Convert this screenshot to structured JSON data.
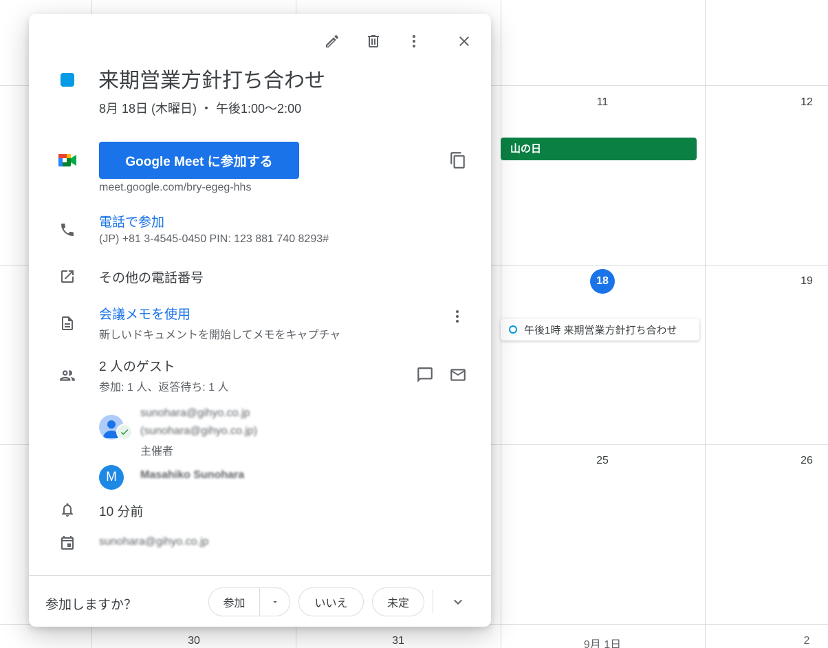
{
  "calendar": {
    "days": [
      "11",
      "12",
      "18",
      "19",
      "25",
      "26",
      "30",
      "31",
      "9月 1日",
      "2"
    ],
    "holiday": "山の日",
    "event_chip": "午後1時 来期営業方針打ち合わせ",
    "colors": {
      "today": "#1a73e8",
      "holiday": "#0b8043",
      "event": "#039be5"
    }
  },
  "popup": {
    "toolbar": {
      "edit": "pencil-icon",
      "delete": "trash-icon",
      "more": "more-vert-icon",
      "close": "close-icon"
    },
    "title": "来期営業方針打ち合わせ",
    "datetime": "8月 18日 (木曜日) ・ 午後1:00～2:00",
    "meet": {
      "button": "Google Meet に参加する",
      "url": "meet.google.com/bry-egeg-hhs"
    },
    "phone": {
      "link": "電話で参加",
      "detail": "(JP) +81 3-4545-0450 PIN: 123 881 740 8293#"
    },
    "more_numbers": "その他の電話番号",
    "notes": {
      "link": "会議メモを使用",
      "detail": "新しいドキュメントを開始してメモをキャプチャ"
    },
    "guests": {
      "heading": "2 人のゲスト",
      "summary": "参加: 1 人、返答待ち: 1 人",
      "list": [
        {
          "line1": "sunohara@gihyo.co.jp",
          "line2": "(sunohara@gihyo.co.jp)",
          "role": "主催者"
        },
        {
          "avatar": "M",
          "name": "Masahiko Sunohara"
        }
      ]
    },
    "reminder": "10 分前",
    "calendar_owner": "sunohara@gihyo.co.jp",
    "rsvp": {
      "question": "参加しますか？",
      "yes": "参加",
      "no": "いいえ",
      "maybe": "未定"
    }
  }
}
